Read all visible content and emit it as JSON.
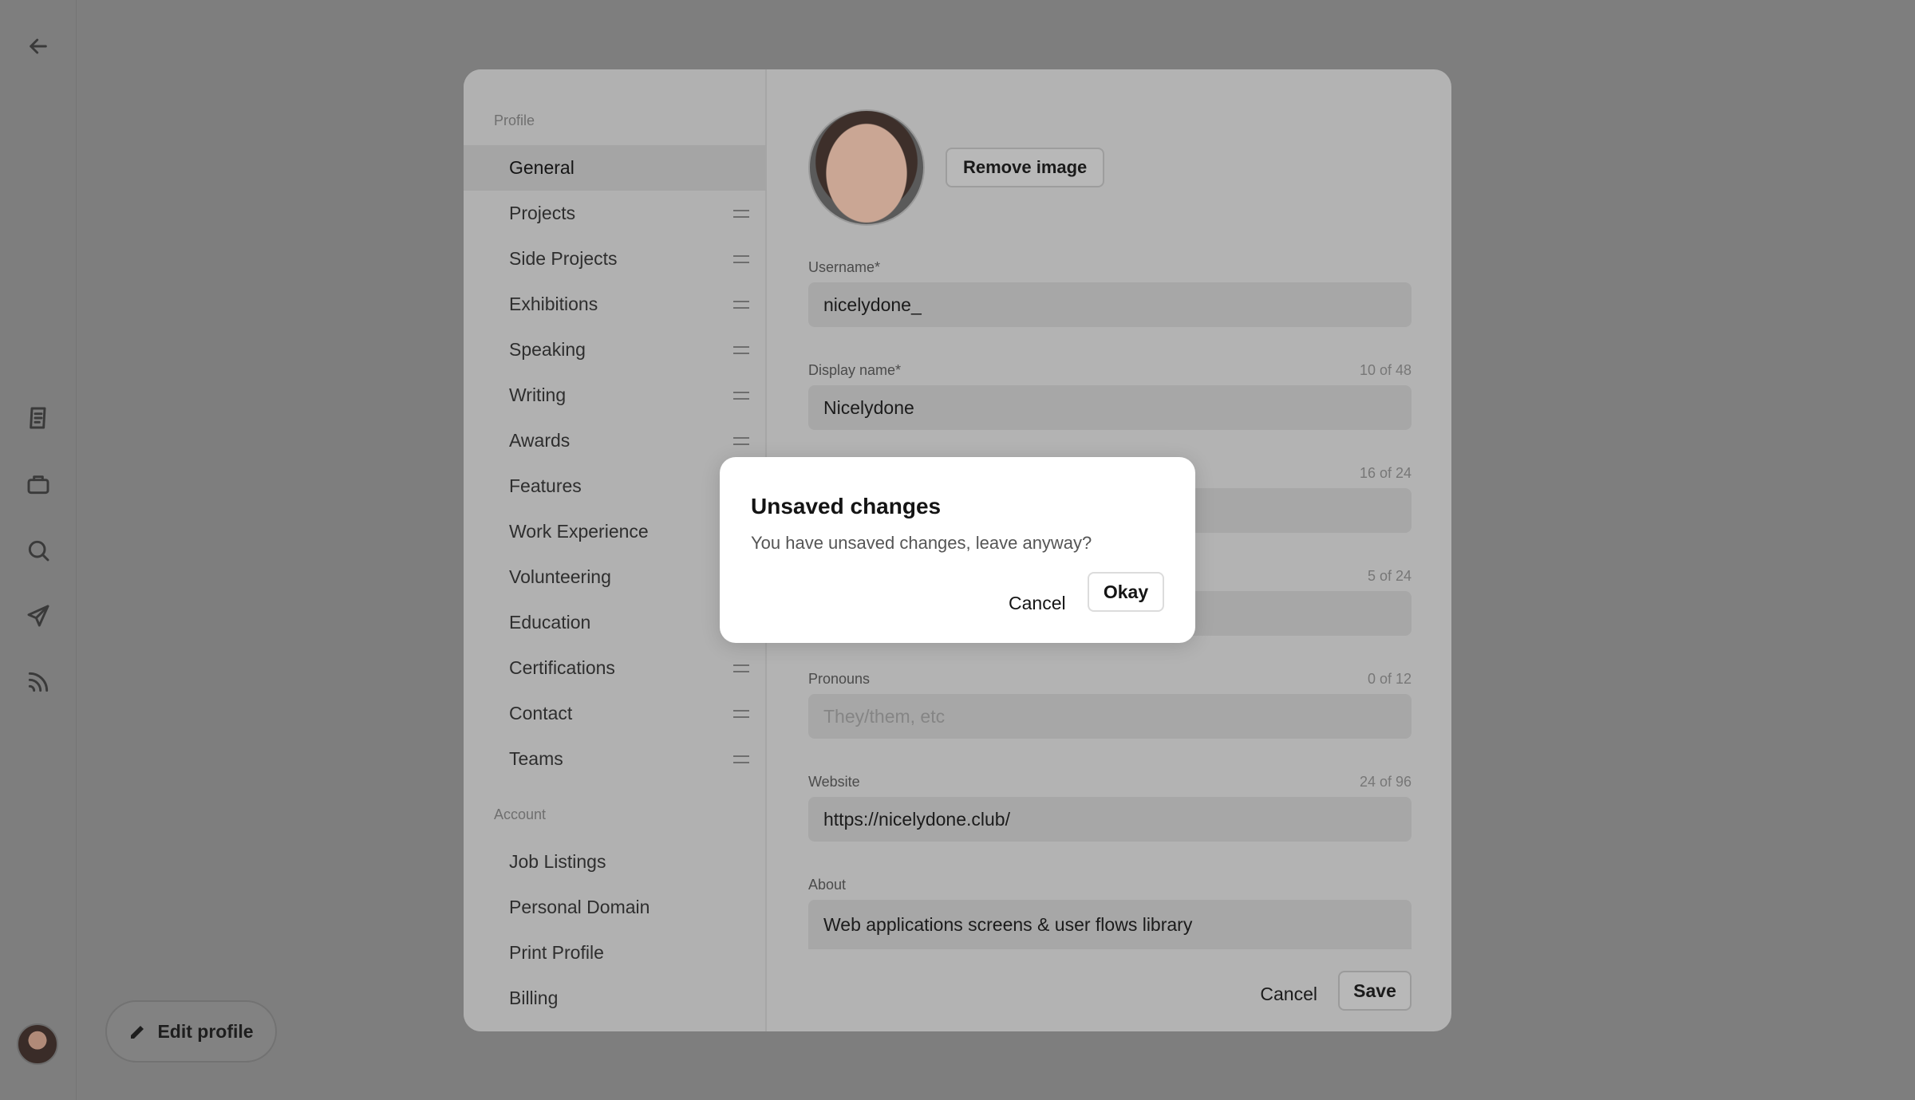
{
  "rail": {
    "icons": [
      "back-arrow-icon",
      "notes-icon",
      "briefcase-icon",
      "search-icon",
      "send-icon",
      "rss-icon"
    ]
  },
  "edit_profile": {
    "label": "Edit profile"
  },
  "nav": {
    "profile_section": "Profile",
    "profile_items": [
      {
        "label": "General",
        "active": true,
        "draggable": false
      },
      {
        "label": "Projects",
        "draggable": true
      },
      {
        "label": "Side Projects",
        "draggable": true
      },
      {
        "label": "Exhibitions",
        "draggable": true
      },
      {
        "label": "Speaking",
        "draggable": true
      },
      {
        "label": "Writing",
        "draggable": true
      },
      {
        "label": "Awards",
        "draggable": true
      },
      {
        "label": "Features",
        "draggable": false
      },
      {
        "label": "Work Experience",
        "draggable": false
      },
      {
        "label": "Volunteering",
        "draggable": false
      },
      {
        "label": "Education",
        "draggable": false
      },
      {
        "label": "Certifications",
        "draggable": true
      },
      {
        "label": "Contact",
        "draggable": true
      },
      {
        "label": "Teams",
        "draggable": true
      }
    ],
    "account_section": "Account",
    "account_items": [
      {
        "label": "Job Listings"
      },
      {
        "label": "Personal Domain"
      },
      {
        "label": "Print Profile"
      },
      {
        "label": "Billing"
      }
    ]
  },
  "form": {
    "remove_image": "Remove image",
    "username": {
      "label": "Username*",
      "value": "nicelydone_"
    },
    "display_name": {
      "label": "Display name*",
      "counter": "10 of 48",
      "value": "Nicelydone"
    },
    "hidden_field_1": {
      "counter": "16 of 24"
    },
    "hidden_field_2": {
      "counter": "5 of 24"
    },
    "pronouns": {
      "label": "Pronouns",
      "counter": "0 of 12",
      "placeholder": "They/them, etc"
    },
    "website": {
      "label": "Website",
      "counter": "24 of 96",
      "value": "https://nicelydone.club/"
    },
    "about": {
      "label": "About",
      "value": "Web applications screens & user flows library"
    },
    "cancel": "Cancel",
    "save": "Save"
  },
  "dialog": {
    "title": "Unsaved changes",
    "message": "You have unsaved changes, leave anyway?",
    "cancel": "Cancel",
    "okay": "Okay"
  }
}
